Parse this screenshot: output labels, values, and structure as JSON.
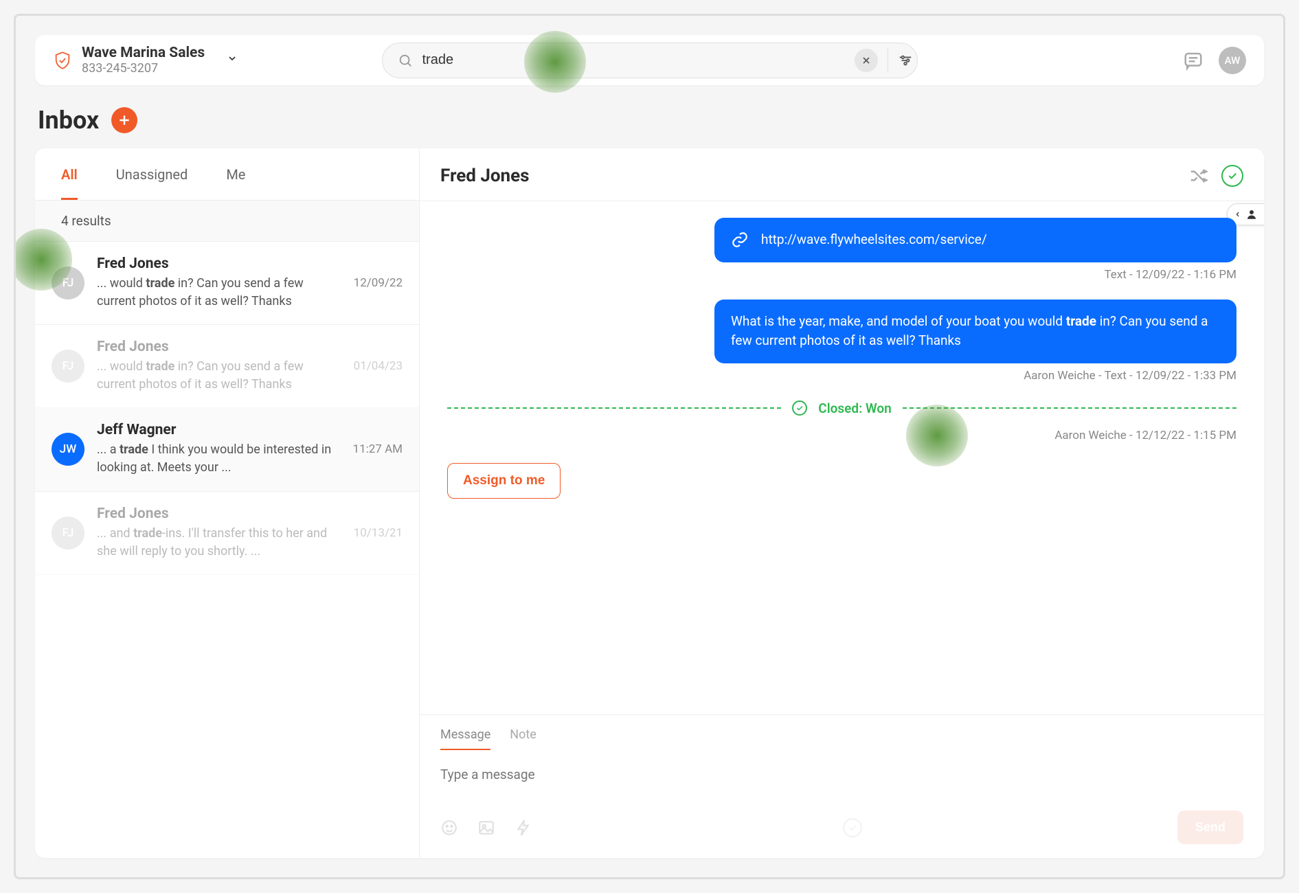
{
  "header": {
    "org_name": "Wave Marina Sales",
    "org_phone": "833-245-3207",
    "search_value": "trade",
    "avatar_initials": "AW"
  },
  "inbox": {
    "title": "Inbox",
    "tabs": {
      "all": "All",
      "unassigned": "Unassigned",
      "me": "Me"
    },
    "results_text": "4 results",
    "conversations": [
      {
        "name": "Fred Jones",
        "initials": "FJ",
        "snippet_pre": "... would ",
        "snippet_hl": "trade",
        "snippet_post": " in? Can you send a few current photos of it as well?  Thanks",
        "date": "12/09/22",
        "muted": false,
        "avatar_class": "ava-grey"
      },
      {
        "name": "Fred Jones",
        "initials": "FJ",
        "snippet_pre": "... would ",
        "snippet_hl": "trade",
        "snippet_post": " in? Can you send a few current photos of it as well?  Thanks",
        "date": "01/04/23",
        "muted": true,
        "avatar_class": "ava-grey"
      },
      {
        "name": "Jeff Wagner",
        "initials": "JW",
        "snippet_pre": "... a ",
        "snippet_hl": "trade",
        "snippet_post": " I think you would be interested in looking at. Meets your ...",
        "date": "11:27 AM",
        "muted": false,
        "avatar_class": "ava-blue"
      },
      {
        "name": "Fred Jones",
        "initials": "FJ",
        "snippet_pre": "... and ",
        "snippet_hl": "trade",
        "snippet_post": "-ins. I'll transfer this to her and she will reply to you shortly. ...",
        "date": "10/13/21",
        "muted": true,
        "avatar_class": "ava-grey"
      }
    ]
  },
  "thread": {
    "contact_name": "Fred Jones",
    "link_bubble": "http://wave.flywheelsites.com/service/",
    "link_meta": "Text - 12/09/22 - 1:16 PM",
    "trade_bubble_pre": "What is the year, make, and model of your boat you would ",
    "trade_bubble_hl": "trade",
    "trade_bubble_post": " in? Can you send a few current photos of it as well?  Thanks",
    "trade_meta": "Aaron Weiche - Text - 12/09/22 - 1:33 PM",
    "status_label": "Closed: Won",
    "status_meta": "Aaron Weiche - 12/12/22 - 1:15 PM",
    "assign_label": "Assign to me"
  },
  "composer": {
    "tab_message": "Message",
    "tab_note": "Note",
    "placeholder": "Type a message",
    "send_label": "Send"
  }
}
